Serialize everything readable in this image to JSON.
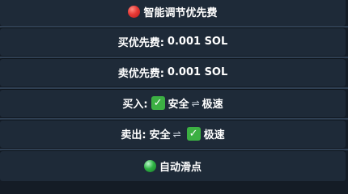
{
  "rows": {
    "smart_fee": {
      "icon": "red-circle-icon",
      "label": "智能调节优先费"
    },
    "buy_fee": {
      "label": "买优先费:",
      "value": "0.001 SOL"
    },
    "sell_fee": {
      "label": "卖优先费:",
      "value": "0.001 SOL"
    },
    "buy_mode": {
      "label": "买入:",
      "check": "✓",
      "option_a": "安全",
      "swap": "⇌",
      "option_b": "极速"
    },
    "sell_mode": {
      "label": "卖出:",
      "option_a": "安全",
      "swap": "⇌",
      "check": "✓",
      "option_b": "极速"
    },
    "auto_slippage": {
      "icon": "green-circle-icon",
      "label": "自动滑点"
    }
  },
  "colors": {
    "background": "#141c26",
    "row": "#1e2a38",
    "separator": "#2f3f52",
    "check": "#3cb043",
    "red_dot": "#e53935",
    "green_dot": "#2fb344"
  }
}
